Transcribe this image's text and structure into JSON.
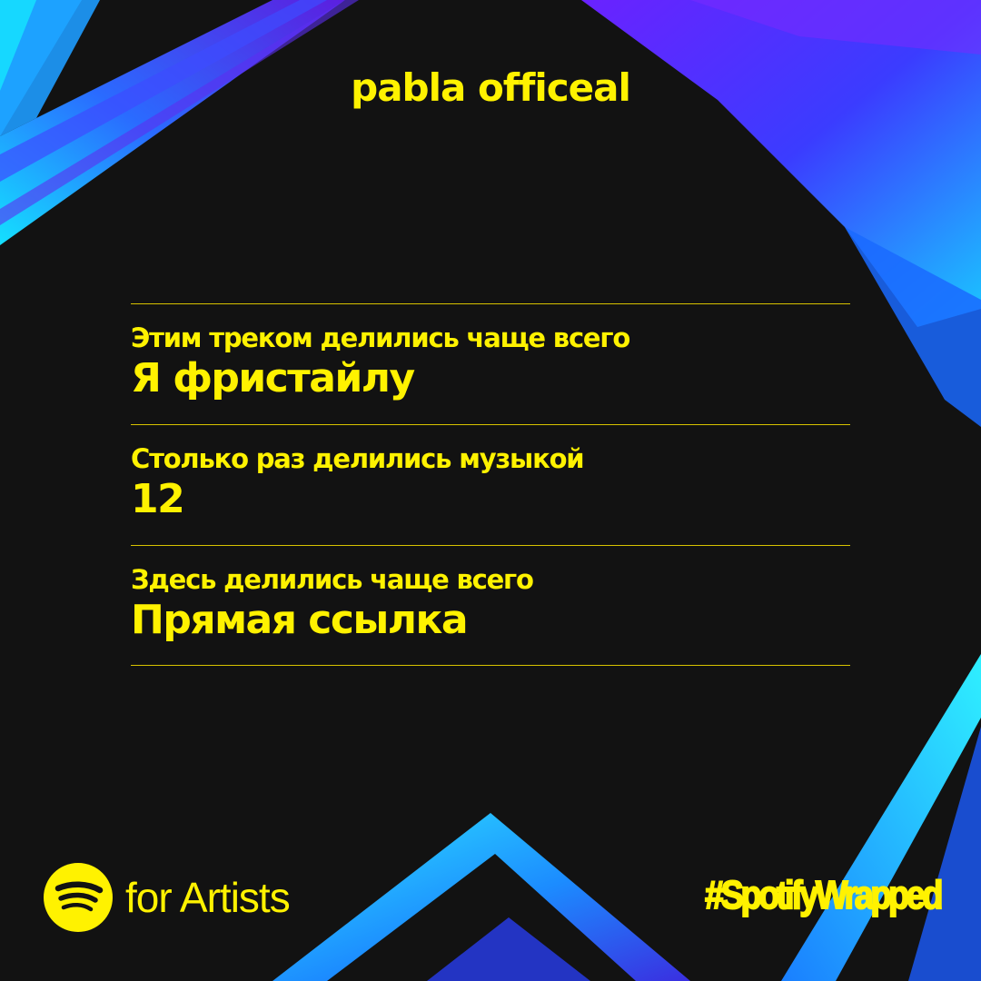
{
  "artist": {
    "name": "pabla officeal"
  },
  "stats": [
    {
      "label": "Этим треком делились чаще всего",
      "value": "Я фристайлу"
    },
    {
      "label": "Столько раз делились музыкой",
      "value": "12"
    },
    {
      "label": "Здесь делились чаще всего",
      "value": "Прямая ссылка"
    }
  ],
  "footer": {
    "brand_text": "for Artists",
    "logo_icon": "spotify-logo-icon",
    "hashtag": "#SpotifyWrapped"
  },
  "colors": {
    "background": "#121212",
    "accent_yellow": "#fff200",
    "cyan": "#18c8ff",
    "violet": "#5a2cff"
  }
}
